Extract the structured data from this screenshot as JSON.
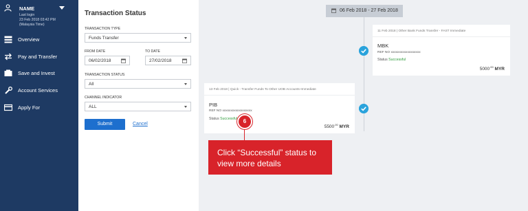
{
  "sidebar": {
    "user": {
      "name": "NAME",
      "last_login_label": "Last login",
      "last_login_time": "23 Feb 2018 03:42 PM",
      "timezone": "(Malaysia Time)"
    },
    "items": [
      {
        "label": "Overview",
        "icon": "overview-icon"
      },
      {
        "label": "Pay and Transfer",
        "icon": "transfer-arrows-icon"
      },
      {
        "label": "Save and Invest",
        "icon": "save-invest-icon"
      },
      {
        "label": "Account Services",
        "icon": "wrench-icon"
      },
      {
        "label": "Apply For",
        "icon": "card-icon"
      }
    ],
    "colors": {
      "background": "#1e3a63"
    }
  },
  "filter_panel": {
    "title": "Transaction Status",
    "transaction_type": {
      "label": "TRANSACTION TYPE",
      "value": "Funds Transfer"
    },
    "from_date": {
      "label": "FROM DATE",
      "value": "06/02/2018"
    },
    "to_date": {
      "label": "TO DATE",
      "value": "27/02/2018"
    },
    "transaction_status": {
      "label": "TRANSACTION STATUS",
      "value": "All"
    },
    "channel_indicator": {
      "label": "CHANNEL INDICATOR",
      "value": "ALL"
    },
    "submit_label": "Submit",
    "cancel_label": "Cancel"
  },
  "timeline": {
    "date_range": "06 Feb 2018 - 27 Feb 2018",
    "cards": [
      {
        "header": "11 Feb 2018 | Other Bank Funds Transfer - FAST Immediate",
        "code": "MBK",
        "ref": "REF NO xxxxxxxxxxxxxxxxxx",
        "status_label": "Status",
        "status_value": "Successful",
        "amount": "5000",
        "cents": ".00",
        "currency": "MYR"
      },
      {
        "header": "13 Feb 2018 | Quick - Transfer Funds To Other UOB Accounts-Immediate",
        "code": "PIB",
        "ref": "REF NO xxxxxxxxxxxxxxxxxx",
        "status_label": "Status",
        "status_value": "Successful",
        "amount": "5500",
        "cents": ".00",
        "currency": "MYR"
      }
    ]
  },
  "callout": {
    "step": "6",
    "text": "Click “Successful” status to view more details"
  },
  "colors": {
    "accent_blue": "#1d6fce",
    "check_blue": "#2aa3dc",
    "success_green": "#2e9b3b",
    "callout_red": "#d8232a"
  }
}
